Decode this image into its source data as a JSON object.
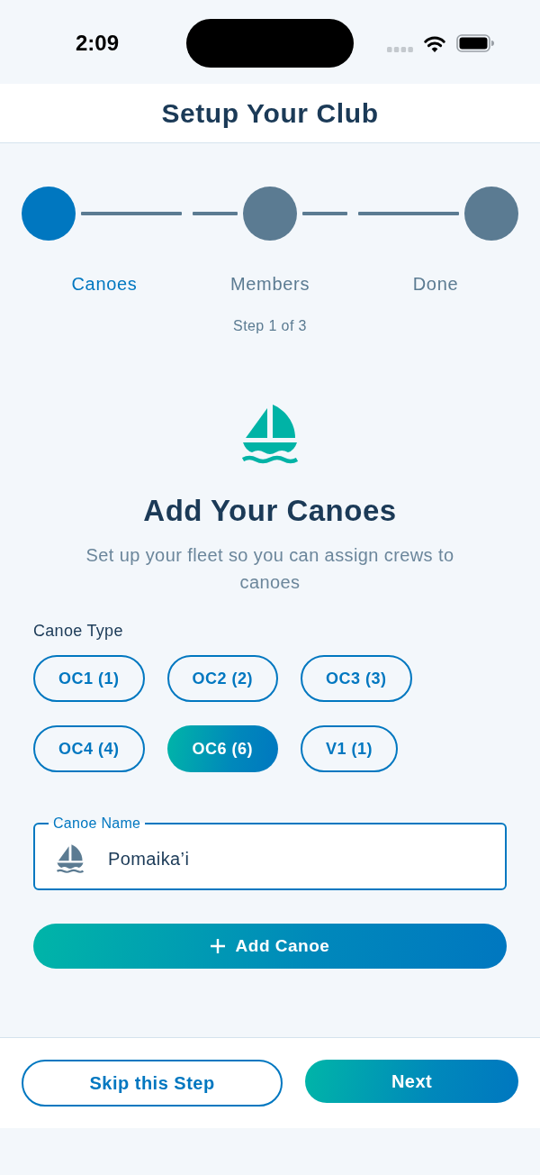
{
  "status_bar": {
    "time": "2:09"
  },
  "header": {
    "title": "Setup Your Club"
  },
  "stepper": {
    "steps": [
      {
        "label": "Canoes",
        "selected": true
      },
      {
        "label": "Members",
        "selected": false
      },
      {
        "label": "Done",
        "selected": false
      }
    ],
    "caption": "Step 1 of 3"
  },
  "intro": {
    "title": "Add Your Canoes",
    "subtitle": "Set up your fleet so you can assign crews to canoes"
  },
  "canoe_type": {
    "label": "Canoe Type",
    "options": [
      {
        "label": "OC1 (1)",
        "selected": false
      },
      {
        "label": "OC2 (2)",
        "selected": false
      },
      {
        "label": "OC3 (3)",
        "selected": false
      },
      {
        "label": "OC4 (4)",
        "selected": false
      },
      {
        "label": "OC6 (6)",
        "selected": true
      },
      {
        "label": "V1 (1)",
        "selected": false
      }
    ]
  },
  "canoe_name": {
    "label": "Canoe Name",
    "value": "Pomaika’i"
  },
  "add_button": {
    "label": "Add Canoe"
  },
  "footer": {
    "buttons": [
      {
        "label": "Skip this Step",
        "kind": "outline"
      },
      {
        "label": "Next",
        "kind": "primary"
      }
    ]
  }
}
